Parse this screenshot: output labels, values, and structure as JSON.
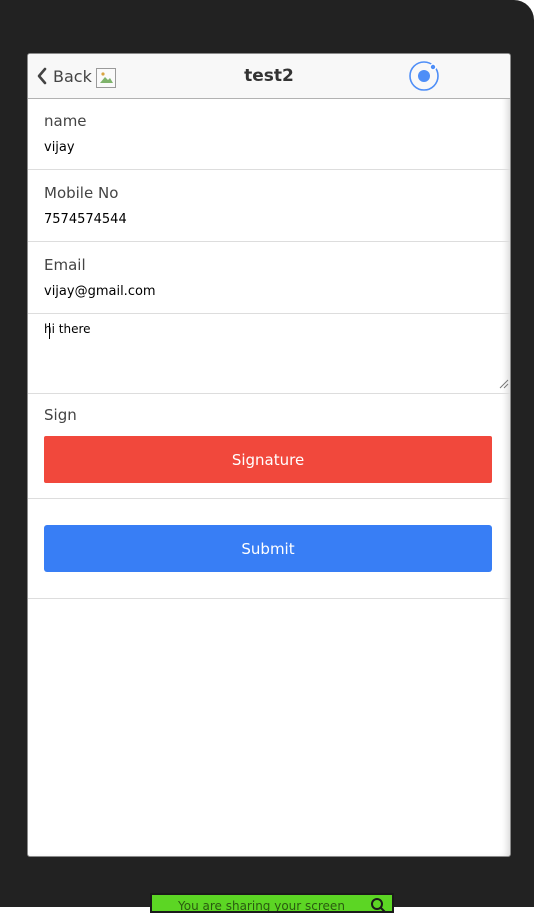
{
  "nav": {
    "back_label": "Back",
    "title": "test2"
  },
  "form": {
    "name": {
      "label": "name",
      "value": "vijay"
    },
    "mobile": {
      "label": "Mobile No",
      "value": "7574574544"
    },
    "email": {
      "label": "Email",
      "value": "vijay@gmail.com"
    },
    "message": {
      "value": "hi there"
    },
    "sign": {
      "label": "Sign"
    }
  },
  "buttons": {
    "signature_label": "Signature",
    "submit_label": "Submit"
  },
  "share_bar": {
    "text": "You are sharing your screen"
  },
  "icons": {
    "back": "chevron-left-icon",
    "broken_image": "broken-image-icon",
    "app_logo": "ionic-logo-icon",
    "search": "search-icon"
  },
  "colors": {
    "signature_button": "#f1483c",
    "submit_button": "#387ef5",
    "nav_background": "#f8f8f8",
    "ionic_blue": "#4e8ef7",
    "share_bar": "#5cd624"
  }
}
